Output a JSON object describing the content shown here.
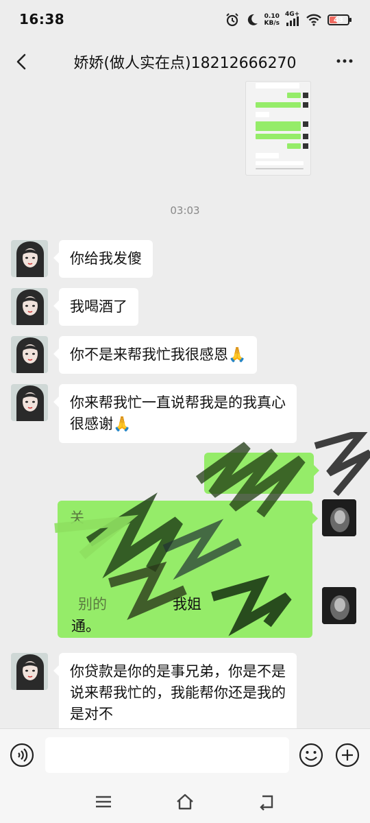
{
  "status_bar": {
    "time": "16:38",
    "net_speed_value": "0.10",
    "net_speed_unit": "KB/s",
    "network": "4G+",
    "battery": "43",
    "battery_level": 0.43
  },
  "header": {
    "title": "娇娇(做人实在点)18212666270",
    "back_icon": "chevron-left-icon",
    "more_icon": "more-dots-icon"
  },
  "chat": {
    "time_separator": "03:03",
    "messages": [
      {
        "sender": "contact",
        "text": "你给我发傻"
      },
      {
        "sender": "contact",
        "text": "我喝酒了"
      },
      {
        "sender": "contact",
        "text": "你不是来帮我忙我很感恩🙏"
      },
      {
        "sender": "contact",
        "text_line1": "你来帮我忙一直说帮我是的我真心",
        "text_line2": "很感谢🙏"
      },
      {
        "sender": "self",
        "text_visible_line1": "关",
        "text_visible_line2": "别的",
        "text_visible_name": "我姐",
        "text_end": "通。"
      },
      {
        "sender": "contact",
        "text_line1": "你贷款是你的是事兄弟，你是不是",
        "text_line2": "说来帮我忙的，我能帮你还是我的",
        "text_line3": "是对不"
      }
    ]
  },
  "input_bar": {
    "voice_icon": "voice-icon",
    "emoji_icon": "emoji-icon",
    "plus_icon": "plus-icon",
    "input_value": ""
  },
  "nav_bar": {
    "menu_icon": "menu-icon",
    "home_icon": "home-icon",
    "back_icon": "back-icon"
  },
  "colors": {
    "background": "#ededed",
    "self_bubble": "#95ec69",
    "contact_bubble": "#ffffff",
    "battery": "#f06a60"
  }
}
